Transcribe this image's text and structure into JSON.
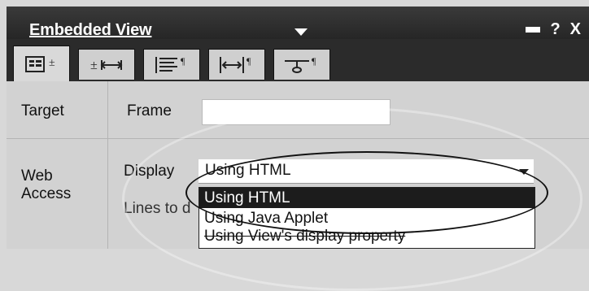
{
  "window": {
    "title": "Embedded View",
    "controls": [
      "minimize-icon",
      "help-icon",
      "close-icon"
    ],
    "help_label": "?",
    "close_label": "X"
  },
  "tabs": [
    {
      "icon": "properties-info-icon",
      "active": true
    },
    {
      "icon": "field-width-icon",
      "active": false
    },
    {
      "icon": "paragraph-align-icon",
      "active": false
    },
    {
      "icon": "margins-paragraph-icon",
      "active": false
    },
    {
      "icon": "hide-when-icon",
      "active": false
    }
  ],
  "target": {
    "label": "Target",
    "frame_label": "Frame",
    "frame_value": ""
  },
  "web_access": {
    "label": "Web Access",
    "display_label": "Display",
    "display_value": "Using HTML",
    "lines_label": "Lines to d",
    "options": [
      "Using HTML",
      "Using Java Applet",
      "Using View's display property"
    ],
    "selected_index": 0
  }
}
